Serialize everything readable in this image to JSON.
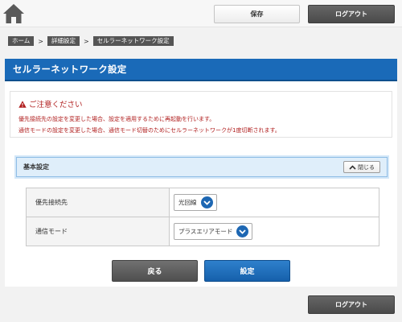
{
  "header": {
    "save_label": "保存",
    "logout_label": "ログアウト"
  },
  "breadcrumb": {
    "items": [
      "ホーム",
      "詳細設定",
      "セルラーネットワーク設定"
    ],
    "separator": ">"
  },
  "page": {
    "title": "セルラーネットワーク設定"
  },
  "notice": {
    "heading": "ご注意ください",
    "lines": [
      "優先接続先の設定を変更した場合、設定を適用するために再起動を行います。",
      "通信モードの設定を変更した場合、通信モード切替のためにセルラーネットワークが1度切断されます。"
    ]
  },
  "section": {
    "title": "基本設定",
    "collapse_label": "閉じる"
  },
  "settings": {
    "rows": [
      {
        "label": "優先接続先",
        "value": "光回線"
      },
      {
        "label": "通信モード",
        "value": "プラスエリアモード"
      }
    ]
  },
  "actions": {
    "back_label": "戻る",
    "submit_label": "設定"
  },
  "footer": {
    "logout_label": "ログアウト"
  },
  "icons": {
    "home": "home-icon",
    "warning": "warning-icon",
    "collapse": "chevron-up-icon",
    "dropdown": "chevron-down-icon"
  },
  "colors": {
    "accent": "#1a6ab8",
    "warning_text": "#b01e1e",
    "section_bg": "#dfeefa"
  }
}
